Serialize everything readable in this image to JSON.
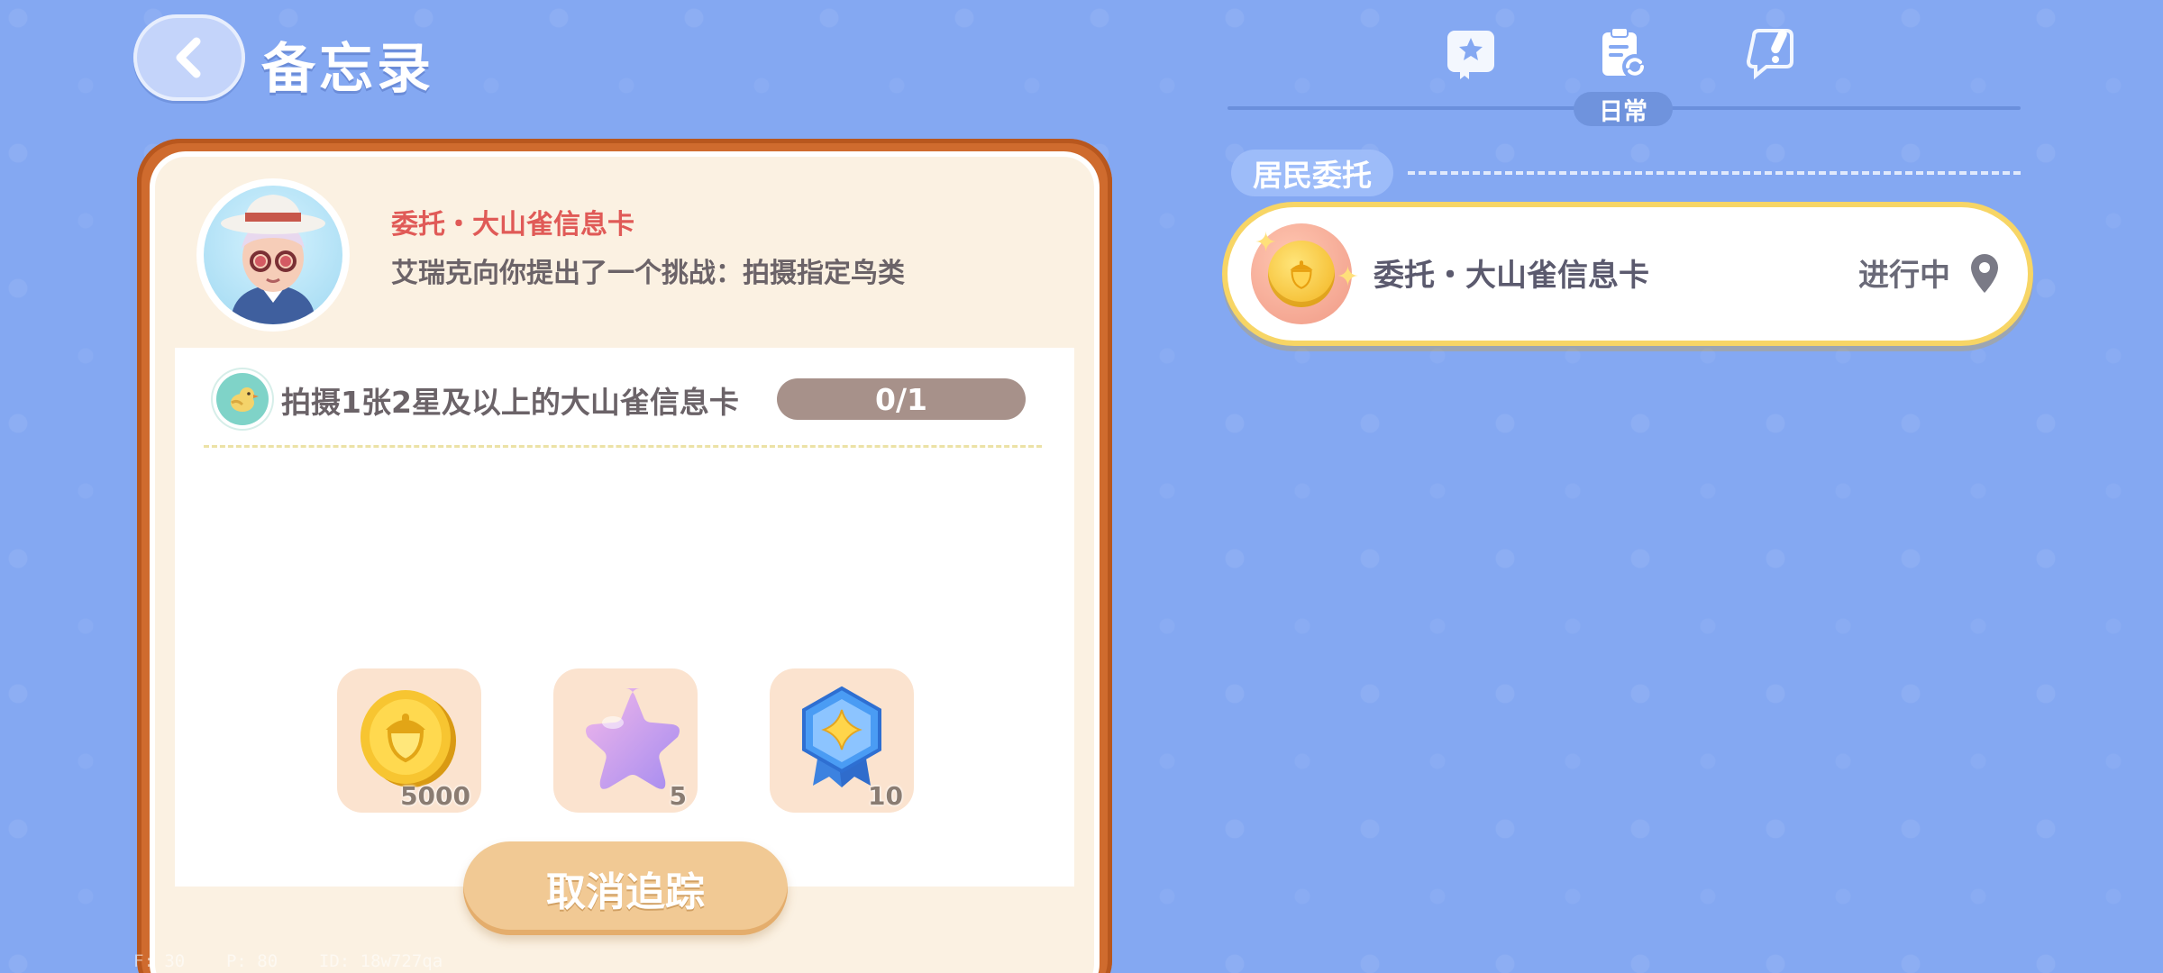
{
  "header": {
    "title": "备忘录"
  },
  "tabs": {
    "active_label": "日常",
    "items": [
      {
        "icon": "book-star-icon"
      },
      {
        "icon": "clipboard-refresh-icon"
      },
      {
        "icon": "chat-alert-icon"
      }
    ]
  },
  "section": {
    "title": "居民委托"
  },
  "quest_list": [
    {
      "name": "委托・大山雀信息卡",
      "status": "进行中",
      "icon": "acorn-coin-icon"
    }
  ],
  "detail": {
    "title": "委托・大山雀信息卡",
    "description": "艾瑞克向你提出了一个挑战：拍摄指定鸟类",
    "task": {
      "text": "拍摄1张2星及以上的大山雀信息卡",
      "progress_text": "0/1",
      "progress_fraction": 0
    },
    "rewards": [
      {
        "icon": "acorn-coin-icon",
        "count": "5000"
      },
      {
        "icon": "purple-star-icon",
        "count": "5"
      },
      {
        "icon": "blue-badge-icon",
        "count": "10"
      }
    ],
    "cancel_label": "取消追踪"
  },
  "debug": {
    "text": "F: 30    P: 80    ID: 18w727qa"
  },
  "colors": {
    "background": "#84a8f2",
    "card_border": "#cf6b2e",
    "quest_title_red": "#e05a57",
    "highlight_yellow": "#f7d565"
  }
}
